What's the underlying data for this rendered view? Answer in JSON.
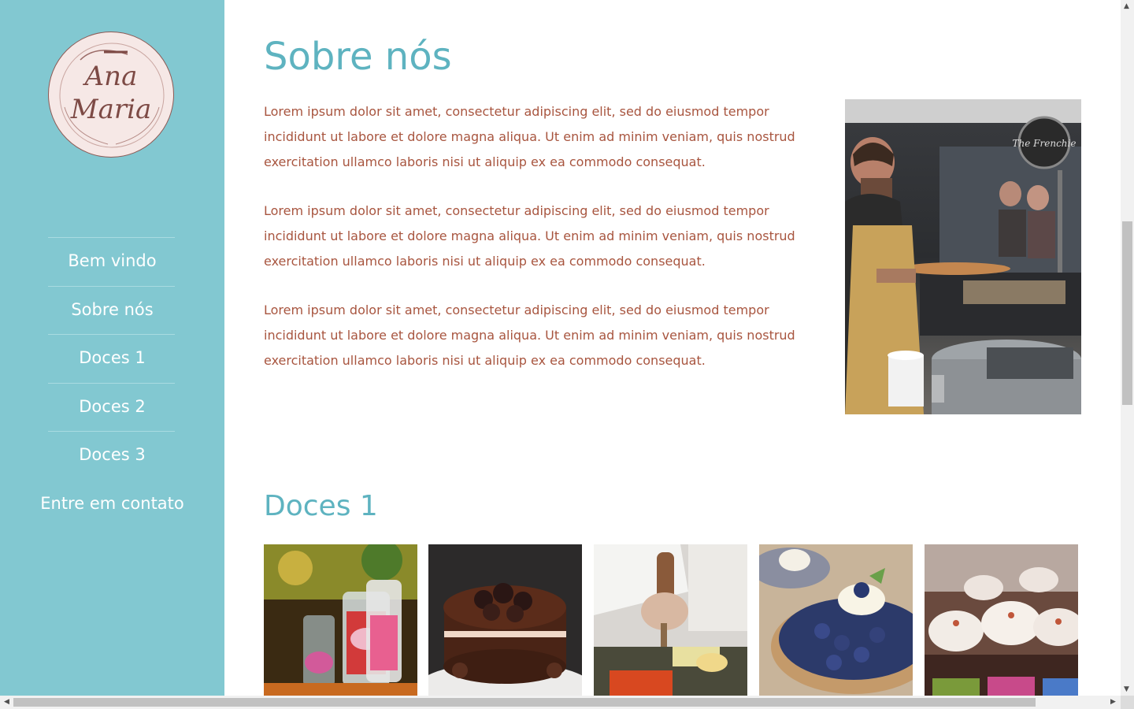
{
  "sidebar": {
    "logo": {
      "line1": "Ana",
      "line2": "Maria"
    },
    "nav": [
      {
        "label": "Bem vindo"
      },
      {
        "label": "Sobre nós"
      },
      {
        "label": "Doces 1"
      },
      {
        "label": "Doces 2"
      },
      {
        "label": "Doces 3"
      },
      {
        "label": "Entre em contato"
      }
    ]
  },
  "about": {
    "title": "Sobre nós",
    "paragraphs": [
      "Lorem ipsum dolor sit amet, consectetur adipiscing elit, sed do eiusmod tempor incididunt ut labore et dolore magna aliqua. Ut enim ad minim veniam, quis nostrud exercitation ullamco laboris nisi ut aliquip ex ea commodo consequat.",
      "Lorem ipsum dolor sit amet, consectetur adipiscing elit, sed do eiusmod tempor incididunt ut labore et dolore magna aliqua. Ut enim ad minim veniam, quis nostrud exercitation ullamco laboris nisi ut aliquip ex ea commodo consequat.",
      "Lorem ipsum dolor sit amet, consectetur adipiscing elit, sed do eiusmod tempor incididunt ut labore et dolore magna aliqua. Ut enim ad minim veniam, quis nostrud exercitation ullamco laboris nisi ut aliquip ex ea commodo consequat."
    ],
    "photo_sign": "The Frenchie"
  },
  "gallery": {
    "title": "Doces 1"
  },
  "colors": {
    "sidebar": "#82c8d1",
    "heading": "#5eb3c0",
    "body_text": "#a8553f"
  }
}
